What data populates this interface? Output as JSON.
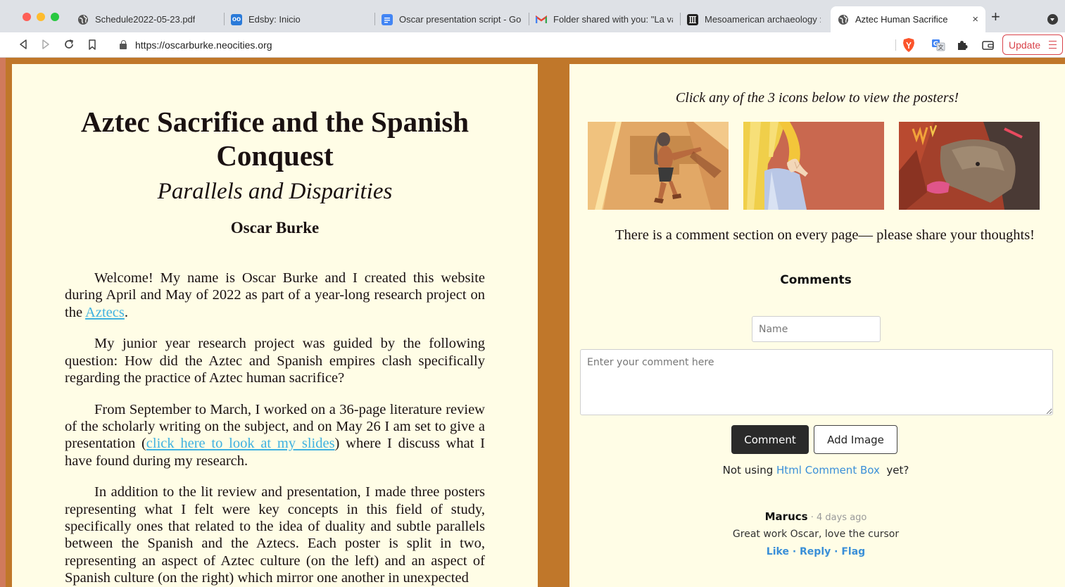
{
  "browser": {
    "tabs": [
      {
        "title": "Schedule2022-05-23.pdf",
        "icon": "globe-icon"
      },
      {
        "title": "Edsby: Inicio",
        "icon": "edsby-icon"
      },
      {
        "title": "Oscar presentation script - Go",
        "icon": "docs-icon"
      },
      {
        "title": "Folder shared with you: \"La va",
        "icon": "gmail-icon"
      },
      {
        "title": "Mesoamerican archaeology : t",
        "icon": "museum-icon"
      },
      {
        "title": "Aztec Human Sacrifice",
        "icon": "globe-icon",
        "active": true
      }
    ],
    "new_tab": "+",
    "close_tab": "×",
    "url": "https://oscarburke.neocities.org",
    "update_label": "Update"
  },
  "page": {
    "title": "Aztec Sacrifice and the Spanish Conquest",
    "subtitle": "Parallels and Disparities",
    "author": "Oscar Burke",
    "p1_before": "Welcome! My name is Oscar Burke and I created this website during April and May of 2022 as part of a year-long research project on the ",
    "p1_link": "Aztecs",
    "p1_after": ".",
    "p2": "My junior year research project was guided by the following question: How did the Aztec and Spanish empires clash specifically regarding the practice of Aztec human sacrifice?",
    "p3_before": "From September to March, I worked on a 36-page literature review of the scholarly writing on the subject, and on May 26 I am set to give a presentation (",
    "p3_link": "click here to look at my slides",
    "p3_after": ") where I discuss what I have found during my research.",
    "p4": "In addition to the lit review and presentation, I made three posters representing what I felt were key concepts in this field of study, specifically ones that related to the idea of duality and subtle parallels between the Spanish and the Aztecs. Each poster is split in two, representing an aspect of Aztec culture (on the left) and an aspect of Spanish culture (on the right) which mirror one another in unexpected"
  },
  "posters": {
    "hint": "Click any of the 3 icons below to view the posters!",
    "items": [
      "poster-1",
      "poster-2",
      "poster-3"
    ]
  },
  "comments": {
    "notice": "There is a comment section on every page— please share your thoughts!",
    "heading": "Comments",
    "name_placeholder": "Name",
    "comment_placeholder": "Enter your comment here",
    "comment_button": "Comment",
    "add_image_button": "Add Image",
    "not_using_before": "Not using ",
    "not_using_link": "Html Comment Box",
    "not_using_after": "  yet?",
    "entries": [
      {
        "author": "Marucs",
        "time": " · 4 days ago",
        "text": "Great work Oscar, love the cursor",
        "like": "Like",
        "reply": "Reply",
        "flag": "Flag",
        "sep": " · "
      }
    ]
  },
  "colors": {
    "background": "#c0772a",
    "panel": "#fffde6",
    "link": "#3fb1e0",
    "accent": "#3a8fd8",
    "update": "#d9434a"
  }
}
